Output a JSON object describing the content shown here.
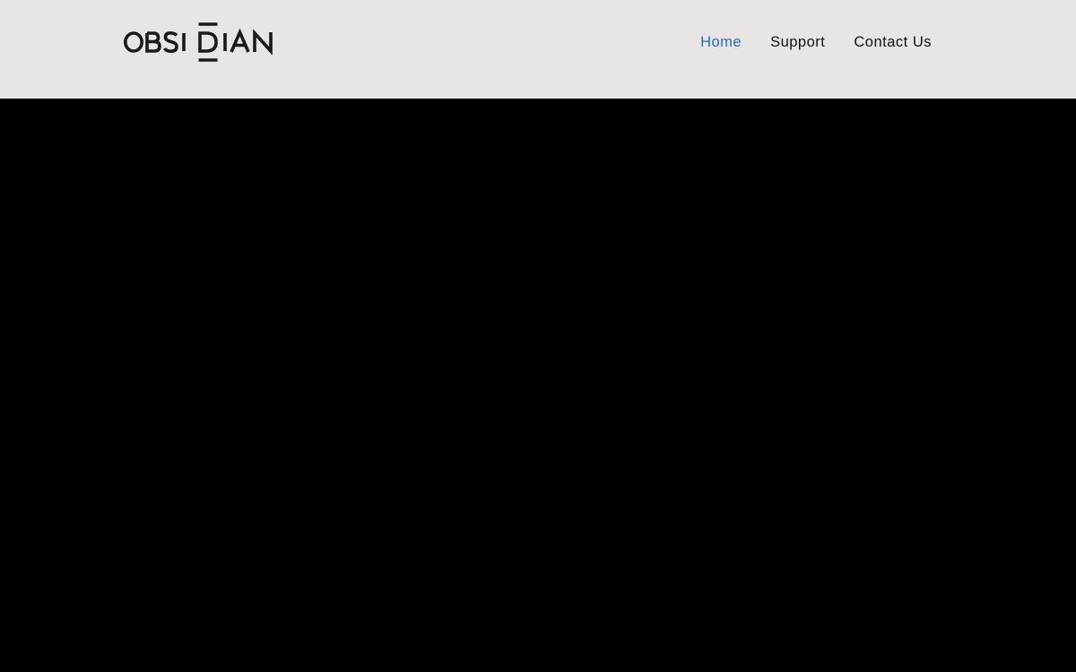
{
  "brand": {
    "logo_text": "OBSIDIAN",
    "logo_color": "#1a1a1a"
  },
  "nav": {
    "items": [
      {
        "label": "Home",
        "active": true
      },
      {
        "label": "Support",
        "active": false
      },
      {
        "label": "Contact Us",
        "active": false
      }
    ],
    "active_color": "#1e6fc0",
    "text_color": "#111111"
  },
  "colors": {
    "header_background": "#e7e5e6",
    "hero_background": "#000000"
  }
}
